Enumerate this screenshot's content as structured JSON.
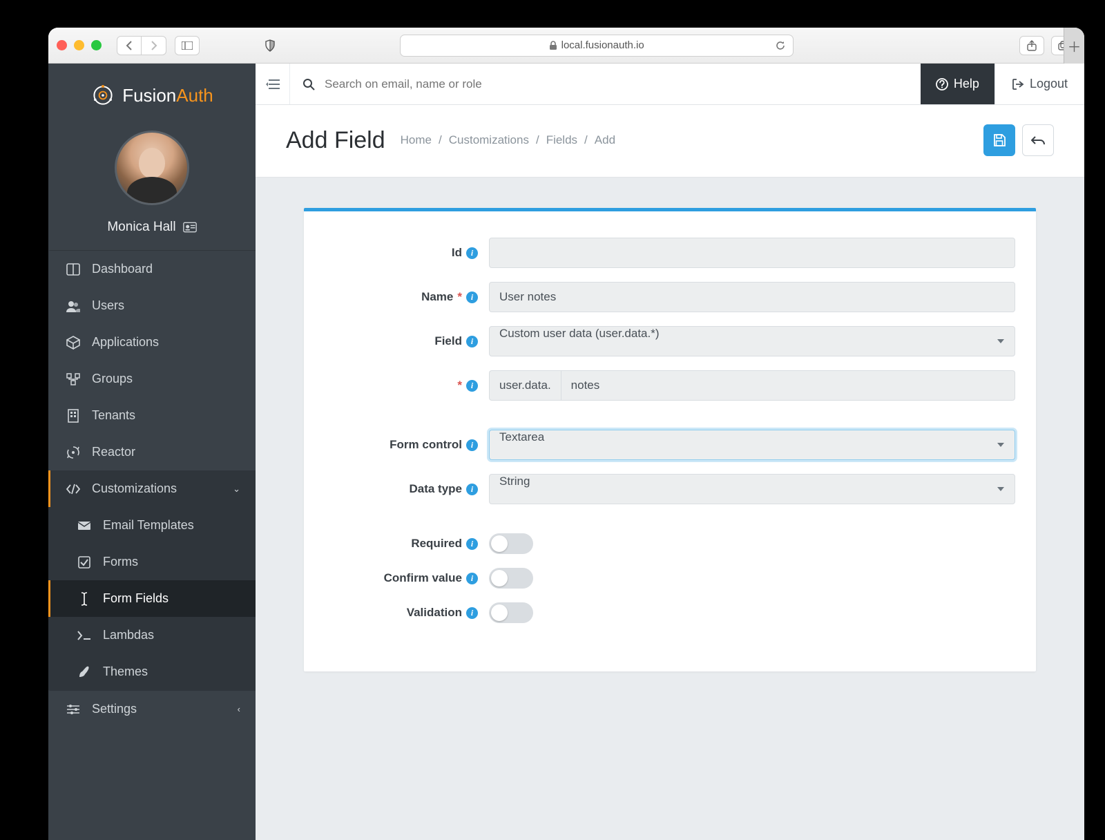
{
  "browser": {
    "url": "local.fusionauth.io"
  },
  "brand": {
    "name": "Fusion",
    "accent": "Auth"
  },
  "user": {
    "name": "Monica Hall"
  },
  "sidebar": {
    "items": [
      {
        "label": "Dashboard"
      },
      {
        "label": "Users"
      },
      {
        "label": "Applications"
      },
      {
        "label": "Groups"
      },
      {
        "label": "Tenants"
      },
      {
        "label": "Reactor"
      },
      {
        "label": "Customizations"
      },
      {
        "label": "Email Templates"
      },
      {
        "label": "Forms"
      },
      {
        "label": "Form Fields"
      },
      {
        "label": "Lambdas"
      },
      {
        "label": "Themes"
      },
      {
        "label": "Settings"
      }
    ]
  },
  "topbar": {
    "search_placeholder": "Search on email, name or role",
    "help": "Help",
    "logout": "Logout"
  },
  "page": {
    "title": "Add Field",
    "crumbs": [
      "Home",
      "Customizations",
      "Fields",
      "Add"
    ]
  },
  "form": {
    "labels": {
      "id": "Id",
      "name": "Name",
      "field": "Field",
      "form_control": "Form control",
      "data_type": "Data type",
      "required": "Required",
      "confirm": "Confirm value",
      "validation": "Validation"
    },
    "values": {
      "id": "",
      "name": "User notes",
      "field": "Custom user data (user.data.*)",
      "key_prefix": "user.data.",
      "key_suffix": "notes",
      "form_control": "Textarea",
      "data_type": "String",
      "required": false,
      "confirm": false,
      "validation": false
    }
  }
}
